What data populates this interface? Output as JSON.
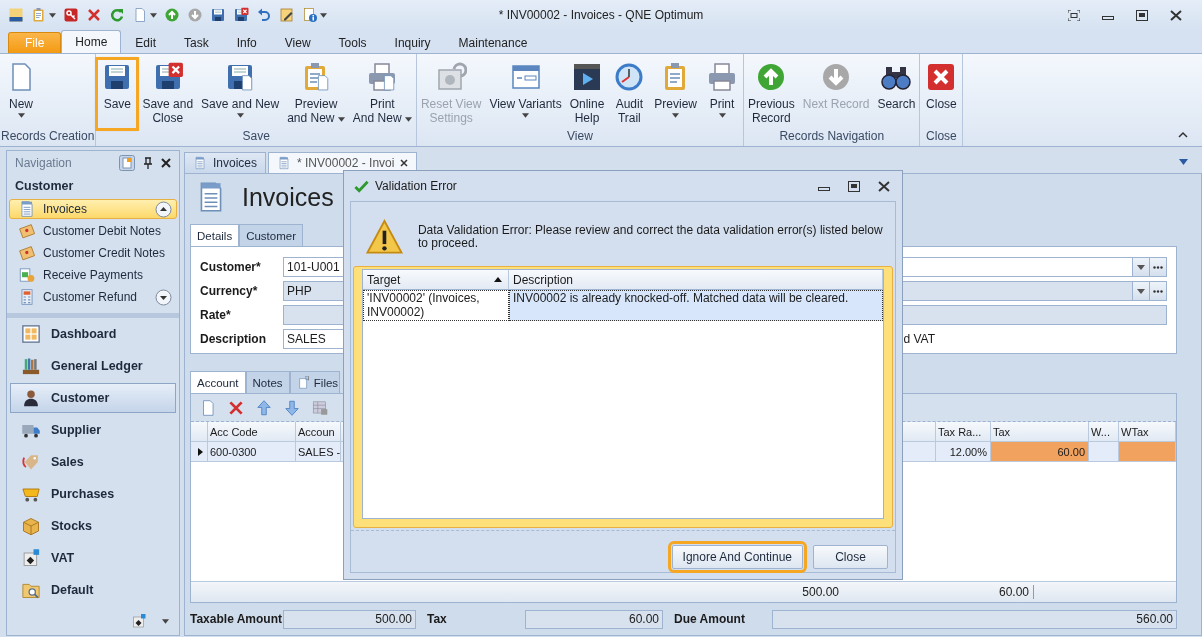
{
  "window": {
    "title": "* INV00002 - Invoices - QNE Optimum"
  },
  "ribbon_tabs": [
    {
      "label": "File",
      "kind": "file",
      "selected": false
    },
    {
      "label": "Home",
      "kind": "tab",
      "selected": true
    },
    {
      "label": "Edit",
      "kind": "tab",
      "selected": false
    },
    {
      "label": "Task",
      "kind": "tab",
      "selected": false
    },
    {
      "label": "Info",
      "kind": "tab",
      "selected": false
    },
    {
      "label": "View",
      "kind": "tab",
      "selected": false
    },
    {
      "label": "Tools",
      "kind": "tab",
      "selected": false
    },
    {
      "label": "Inquiry",
      "kind": "tab",
      "selected": false
    },
    {
      "label": "Maintenance",
      "kind": "tab",
      "selected": false
    }
  ],
  "ribbon_groups": [
    {
      "label": "Records Creation",
      "buttons": [
        {
          "label": "New",
          "dropdown": true,
          "disabled": false,
          "highlighted": false
        }
      ]
    },
    {
      "label": "Save",
      "buttons": [
        {
          "label": "Save",
          "dropdown": false,
          "disabled": false,
          "highlighted": true
        },
        {
          "label": "Save and\nClose",
          "dropdown": false,
          "disabled": false,
          "highlighted": false
        },
        {
          "label": "Save and New",
          "dropdown": true,
          "disabled": false,
          "highlighted": false
        },
        {
          "label": "Preview\nand New",
          "dropdown": true,
          "disabled": false,
          "highlighted": false
        },
        {
          "label": "Print\nAnd New",
          "dropdown": true,
          "disabled": false,
          "highlighted": false
        }
      ]
    },
    {
      "label": "View",
      "buttons": [
        {
          "label": "Reset View\nSettings",
          "dropdown": false,
          "disabled": true,
          "highlighted": false
        },
        {
          "label": "View Variants",
          "dropdown": true,
          "disabled": false,
          "highlighted": false
        },
        {
          "label": "Online\nHelp",
          "dropdown": false,
          "disabled": false,
          "highlighted": false
        },
        {
          "label": "Audit\nTrail",
          "dropdown": false,
          "disabled": false,
          "highlighted": false
        },
        {
          "label": "Preview",
          "dropdown": true,
          "disabled": false,
          "highlighted": false
        },
        {
          "label": "Print",
          "dropdown": true,
          "disabled": false,
          "highlighted": false
        }
      ]
    },
    {
      "label": "Records Navigation",
      "buttons": [
        {
          "label": "Previous\nRecord",
          "dropdown": false,
          "disabled": false,
          "highlighted": false
        },
        {
          "label": "Next Record",
          "dropdown": false,
          "disabled": true,
          "highlighted": false
        },
        {
          "label": "Search",
          "dropdown": false,
          "disabled": false,
          "highlighted": false
        }
      ]
    },
    {
      "label": "Close",
      "buttons": [
        {
          "label": "Close",
          "dropdown": false,
          "disabled": false,
          "highlighted": false
        }
      ]
    }
  ],
  "navigation": {
    "title": "Navigation",
    "group_title": "Customer",
    "items": [
      {
        "label": "Invoices",
        "selected": true
      },
      {
        "label": "Customer Debit Notes",
        "selected": false
      },
      {
        "label": "Customer Credit Notes",
        "selected": false
      },
      {
        "label": "Receive Payments",
        "selected": false
      },
      {
        "label": "Customer Refund",
        "selected": false
      }
    ],
    "modules": [
      {
        "label": "Dashboard",
        "selected": false
      },
      {
        "label": "General Ledger",
        "selected": false
      },
      {
        "label": "Customer",
        "selected": true
      },
      {
        "label": "Supplier",
        "selected": false
      },
      {
        "label": "Sales",
        "selected": false
      },
      {
        "label": "Purchases",
        "selected": false
      },
      {
        "label": "Stocks",
        "selected": false
      },
      {
        "label": "VAT",
        "selected": false
      },
      {
        "label": "Default",
        "selected": false
      }
    ]
  },
  "document_tabs": [
    {
      "label": "Invoices",
      "selected": false
    },
    {
      "label": "* INV00002 - Invoi",
      "selected": true
    }
  ],
  "form": {
    "title": "Invoices",
    "tabs": [
      {
        "label": "Details",
        "selected": true
      },
      {
        "label": "Customer",
        "selected": false
      }
    ],
    "fields": [
      {
        "label": "Customer*",
        "kind": "combo",
        "value": "101-U001",
        "readonly": false
      },
      {
        "label": "Currency*",
        "kind": "combo",
        "value": "PHP",
        "readonly": true
      },
      {
        "label": "Rate*",
        "kind": "text",
        "readonly": true
      },
      {
        "label": "Description",
        "kind": "short",
        "value": "SALES",
        "readonly": false
      }
    ],
    "vat_option_label": "d VAT"
  },
  "detail_tabs": [
    {
      "label": "Account",
      "selected": true
    },
    {
      "label": "Notes",
      "selected": false
    },
    {
      "label": "Files",
      "selected": false
    }
  ],
  "grid": {
    "columns": [
      {
        "label": "Acc Code",
        "highlighted": false
      },
      {
        "label": "Accoun",
        "highlighted": false
      },
      {
        "label": "Tax Ra...",
        "highlighted": false
      },
      {
        "label": "Tax",
        "highlighted": true
      },
      {
        "label": "W...",
        "highlighted": false
      },
      {
        "label": "WTax",
        "highlighted": true
      }
    ],
    "rows": [
      {
        "current": true,
        "acc_code": "600-0300",
        "account": "SALES -",
        "tax_rate": "12.00%",
        "tax": "60.00"
      }
    ],
    "footer": {
      "amount_total": "500.00",
      "tax_total": "60.00"
    }
  },
  "totals": [
    {
      "label": "Taxable Amount",
      "value": "500.00"
    },
    {
      "label": "Tax",
      "value": "60.00"
    },
    {
      "label": "Due Amount",
      "value": "560.00"
    }
  ],
  "dialog": {
    "title": "Validation Error",
    "message": "Data Validation Error: Please review and correct the data validation error(s) listed below to proceed.",
    "columns": [
      {
        "label": "Target",
        "sorted": true
      },
      {
        "label": "Description",
        "sorted": false
      }
    ],
    "rows": [
      {
        "target": "'INV00002' (Invoices, INV00002)",
        "description": "INV00002 is already knocked-off. Matched data will be cleared.",
        "selected": true
      }
    ],
    "buttons": [
      {
        "label": "Ignore And Continue",
        "highlighted": true
      },
      {
        "label": "Close",
        "highlighted": false
      }
    ]
  }
}
